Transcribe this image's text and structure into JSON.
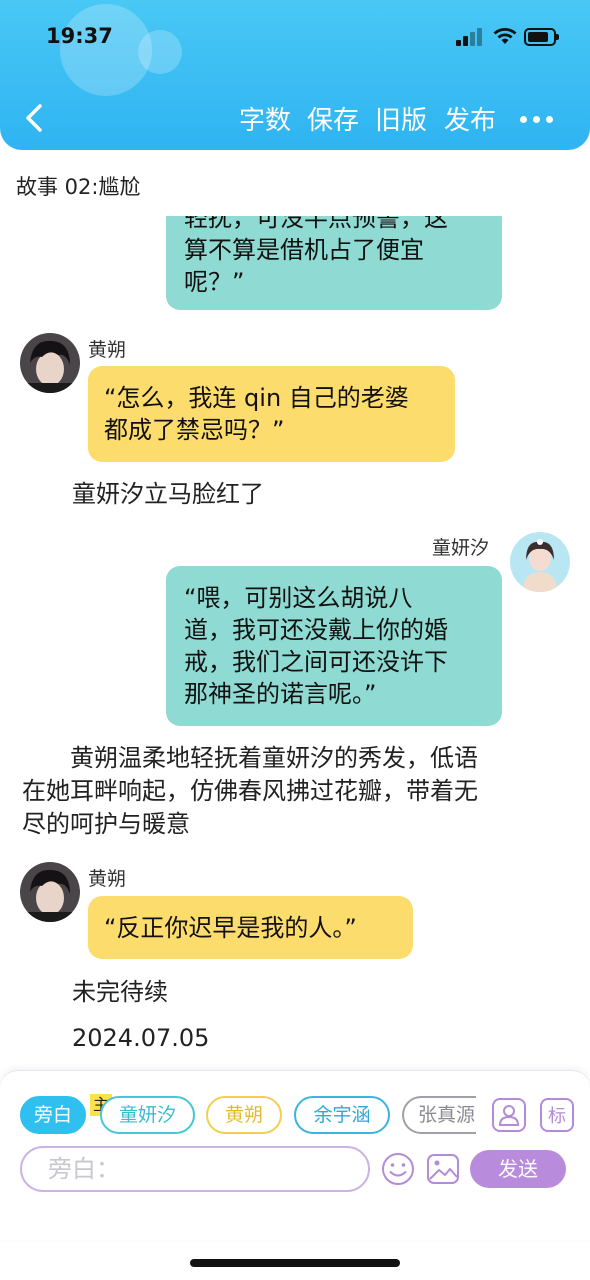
{
  "status_bar": {
    "time": "19:37"
  },
  "header": {
    "back_label": "返回",
    "buttons": [
      "字数",
      "保存",
      "旧版",
      "发布"
    ]
  },
  "story": {
    "title": "故事 02:尴尬"
  },
  "messages": {
    "m1": {
      "text": "轻抚，可没半点预警，这\n算不算是借机占了便宜\n呢？”"
    },
    "m2": {
      "speaker": "黄朔",
      "text": "“怎么，我连 qin 自己的老婆\n都成了禁忌吗？”"
    },
    "n1": {
      "text": "童妍汐立马脸红了"
    },
    "m3": {
      "speaker": "童妍汐",
      "text": "“喂，可别这么胡说八\n道，我可还没戴上你的婚\n戒，我们之间可还没许下\n那神圣的诺言呢。”"
    },
    "n2": {
      "text": "　　黄朔温柔地轻抚着童妍汐的秀发，低语\n在她耳畔响起，仿佛春风拂过花瓣，带着无\n尽的呵护与暖意"
    },
    "m4": {
      "speaker": "黄朔",
      "text": "“反正你迟早是我的人。”"
    },
    "n3": {
      "text": "未完待续"
    },
    "n4": {
      "text": "2024.07.05"
    }
  },
  "composer": {
    "roles": [
      {
        "label": "旁白",
        "color": "#2fc0ef",
        "filled": true
      },
      {
        "label": "童妍汐",
        "color": "#45c7d8",
        "filled": false
      },
      {
        "label": "黄朔",
        "color": "#f0d04c",
        "filled": false
      },
      {
        "label": "余宇涵",
        "color": "#38b6e0",
        "filled": false
      },
      {
        "label": "张真源",
        "color": "#a0a0a8",
        "filled": false
      }
    ],
    "main_tag": "主",
    "input_placeholder": "旁白：",
    "send_label": "发送"
  },
  "colors": {
    "header": "#2fb4f2",
    "teal_bubble": "#8fdad2",
    "yellow_bubble": "#fddc6e",
    "accent_purple": "#b88bdc"
  },
  "icons": [
    "chevron-left-icon",
    "more-icon",
    "person-icon",
    "tag-icon",
    "emoji-icon",
    "image-icon",
    "signal-icon",
    "wifi-icon",
    "battery-icon"
  ]
}
